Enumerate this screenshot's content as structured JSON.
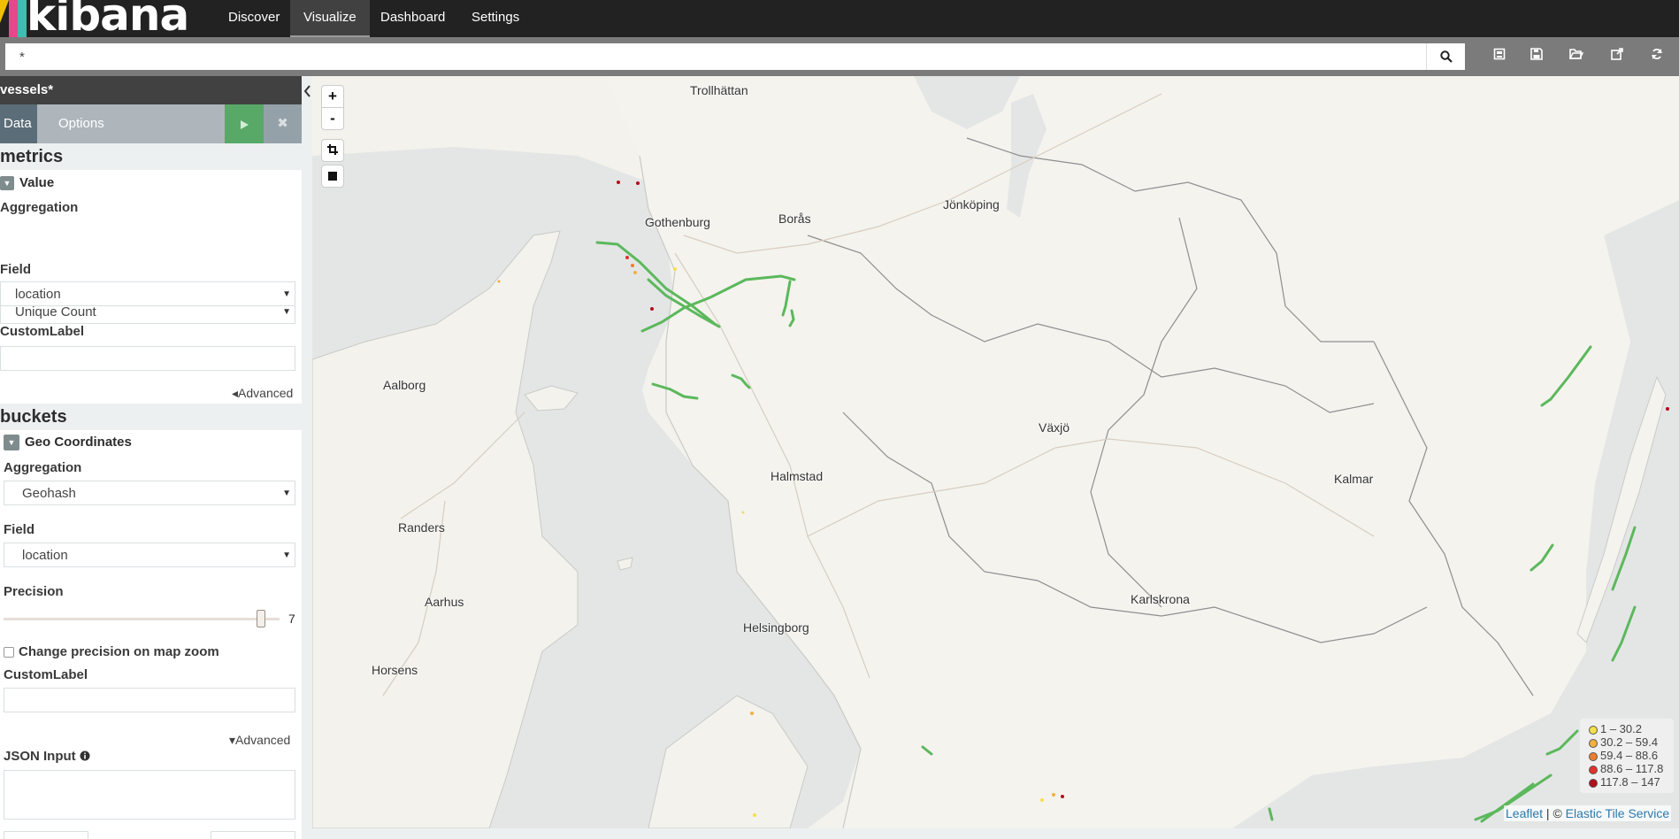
{
  "app": {
    "logo_text": "kibana",
    "nav": [
      {
        "label": "Discover"
      },
      {
        "label": "Visualize"
      },
      {
        "label": "Dashboard"
      },
      {
        "label": "Settings"
      }
    ],
    "active_nav": "Visualize"
  },
  "search": {
    "query": "*",
    "icon": "search-icon"
  },
  "toolbar": {
    "icons": [
      "new-visualization-icon",
      "save-icon",
      "open-icon",
      "share-icon",
      "refresh-icon"
    ]
  },
  "sidebar": {
    "title": "vessels*",
    "tabs": [
      {
        "label": "Data"
      },
      {
        "label": "Options"
      }
    ],
    "active_tab": "Data",
    "run_icon": "play-icon",
    "cancel_icon": "close-icon",
    "collapse_icon": "chevron-left-icon",
    "metrics": {
      "heading": "metrics",
      "agg_title": "Value",
      "aggregation_label": "Aggregation",
      "aggregation_value": "Unique Count",
      "field_label": "Field",
      "field_value": "location",
      "custom_label": "CustomLabel",
      "advanced": "Advanced"
    },
    "buckets": {
      "heading": "buckets",
      "agg_title": "Geo Coordinates",
      "aggregation_label": "Aggregation",
      "aggregation_value": "Geohash",
      "field_label": "Field",
      "field_value": "location",
      "precision_label": "Precision",
      "precision_value": "7",
      "change_precision_label": "Change precision on map zoom",
      "change_precision_checked": false,
      "custom_label": "CustomLabel",
      "advanced": "Advanced",
      "json_input_label": "JSON Input",
      "info_icon": "info-icon"
    }
  },
  "map": {
    "controls": {
      "zoom_in": "+",
      "zoom_out": "-",
      "crop_icon": "crop-icon",
      "square_icon": "draw-rectangle-icon"
    },
    "cities": [
      {
        "name": "Trollhättan"
      },
      {
        "name": "Gothenburg"
      },
      {
        "name": "Borås"
      },
      {
        "name": "Jönköping"
      },
      {
        "name": "Aalborg"
      },
      {
        "name": "Växjö"
      },
      {
        "name": "Halmstad"
      },
      {
        "name": "Kalmar"
      },
      {
        "name": "Randers"
      },
      {
        "name": "Aarhus"
      },
      {
        "name": "Helsingborg"
      },
      {
        "name": "Karlskrona"
      },
      {
        "name": "Horsens"
      }
    ],
    "legend": [
      {
        "label": "1 – 30.2",
        "color": "#f5e04a"
      },
      {
        "label": "30.2 – 59.4",
        "color": "#f3b03a"
      },
      {
        "label": "59.4 – 88.6",
        "color": "#ef7d2c"
      },
      {
        "label": "88.6 – 117.8",
        "color": "#e3302b"
      },
      {
        "label": "117.8 – 147",
        "color": "#b30e1a"
      }
    ],
    "attribution": {
      "leaflet": "Leaflet",
      "separator": " | © ",
      "tiles": "Elastic Tile Service"
    },
    "track_color": "#5cb85c"
  }
}
